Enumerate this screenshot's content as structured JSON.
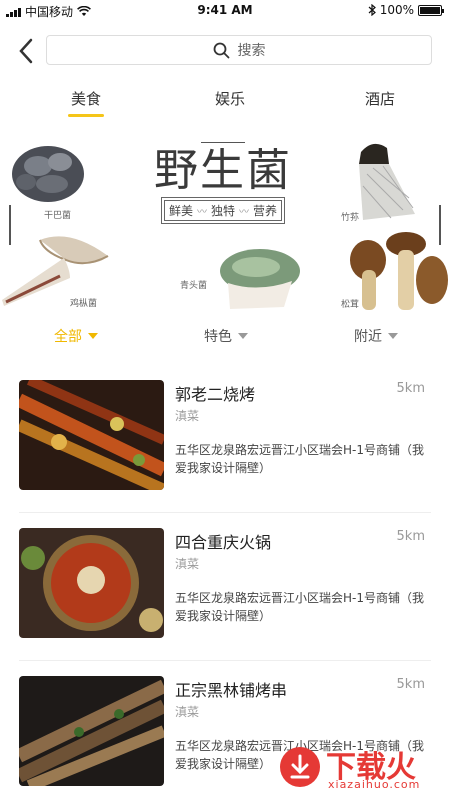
{
  "status_bar": {
    "carrier": "中国移动",
    "time": "9:41 AM",
    "battery": "100%",
    "battery_level": 1.0
  },
  "search": {
    "placeholder": "搜索"
  },
  "tabs": [
    {
      "label": "美食",
      "active": true
    },
    {
      "label": "娱乐",
      "active": false
    },
    {
      "label": "酒店",
      "active": false
    }
  ],
  "banner": {
    "title": "野生菌",
    "tags": [
      "鲜美",
      "独特",
      "营养"
    ],
    "mushrooms": [
      "干巴菌",
      "竹荪",
      "鸡枞菌",
      "青头菌",
      "松茸"
    ]
  },
  "filters": [
    {
      "label": "全部",
      "active": true
    },
    {
      "label": "特色",
      "active": false
    },
    {
      "label": "附近",
      "active": false
    }
  ],
  "restaurants": [
    {
      "name": "郭老二烧烤",
      "distance": "5km",
      "category": "滇菜",
      "address": "五华区龙泉路宏远晋江小区瑞会H-1号商铺（我爱我家设计隔壁）"
    },
    {
      "name": "四合重庆火锅",
      "distance": "5km",
      "category": "滇菜",
      "address": "五华区龙泉路宏远晋江小区瑞会H-1号商铺（我爱我家设计隔壁）"
    },
    {
      "name": "正宗黑林铺烤串",
      "distance": "5km",
      "category": "滇菜",
      "address": "五华区龙泉路宏远晋江小区瑞会H-1号商铺（我爱我家设计隔壁）"
    }
  ],
  "watermark": {
    "text": "下载火",
    "url": "xiazaihuo.com"
  },
  "colors": {
    "accent": "#f5c518",
    "text": "#333333",
    "muted": "#999999",
    "watermark": "#e53935"
  }
}
